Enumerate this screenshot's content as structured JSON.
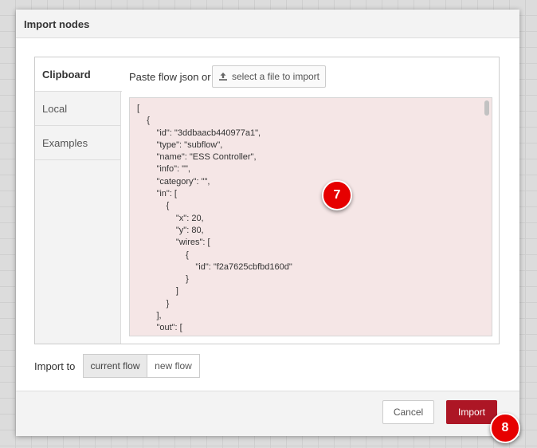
{
  "dialog": {
    "title": "Import nodes",
    "tabs": [
      {
        "label": "Clipboard",
        "active": true
      },
      {
        "label": "Local",
        "active": false
      },
      {
        "label": "Examples",
        "active": false
      }
    ],
    "paste_label": "Paste flow json or",
    "file_button_label": "select a file to import",
    "file_button_icon": "upload-icon",
    "json_text": "[\n    {\n        \"id\": \"3ddbaacb440977a1\",\n        \"type\": \"subflow\",\n        \"name\": \"ESS Controller\",\n        \"info\": \"\",\n        \"category\": \"\",\n        \"in\": [\n            {\n                \"x\": 20,\n                \"y\": 80,\n                \"wires\": [\n                    {\n                        \"id\": \"f2a7625cbfbd160d\"\n                    }\n                ]\n            }\n        ],\n        \"out\": [\n            {",
    "import_to_label": "Import to",
    "import_to_options": [
      {
        "label": "current flow",
        "selected": true
      },
      {
        "label": "new flow",
        "selected": false
      }
    ],
    "cancel_label": "Cancel",
    "import_label": "Import"
  },
  "badges": {
    "first": "7",
    "second": "8"
  },
  "colors": {
    "import_button": "#ad1625",
    "json_background": "#f5e6e6",
    "badge": "#e60000"
  }
}
